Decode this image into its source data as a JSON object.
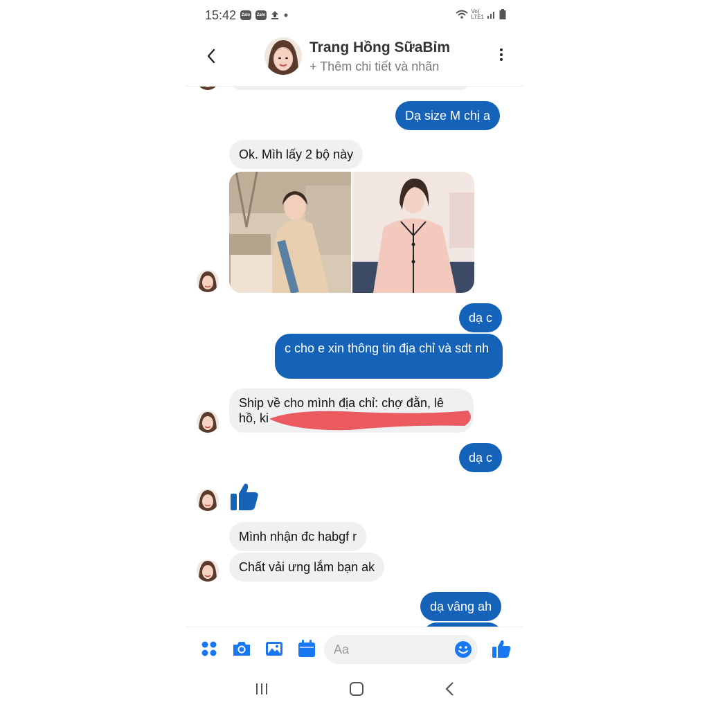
{
  "status": {
    "time": "15:42",
    "zalo": "Zalo",
    "net_top": "Vo)",
    "net_bottom": "LTE1"
  },
  "header": {
    "name": "Trang Hồng SữaBỉm",
    "subtitle": "+ Thêm chi tiết và nhãn"
  },
  "messages": {
    "m1": "Dạ size M chị a",
    "m2": "Ok. Mìh lấy 2 bộ này",
    "m3": "dạ c",
    "m4": "c cho e xin thông tin địa chỉ và sdt nh",
    "m5": "Ship về cho mình địa chỉ: chợ đằn, lê hồ, ki",
    "m6": "dạ c",
    "m7": "Mình nhận đc habgf r",
    "m8": "Chất vải ưng lắm bạn ak",
    "m9": "dạ vâng ah"
  },
  "composer": {
    "placeholder": "Aa"
  },
  "colors": {
    "accent": "#1463b9",
    "icon": "#1877f2",
    "incoming": "#eef0f2",
    "redact": "#ea5a5f"
  },
  "icons": [
    "back-arrow-icon",
    "more-options-icon",
    "apps-grid-icon",
    "camera-icon",
    "gallery-icon",
    "calendar-icon",
    "emoji-icon",
    "thumbs-up-icon"
  ]
}
